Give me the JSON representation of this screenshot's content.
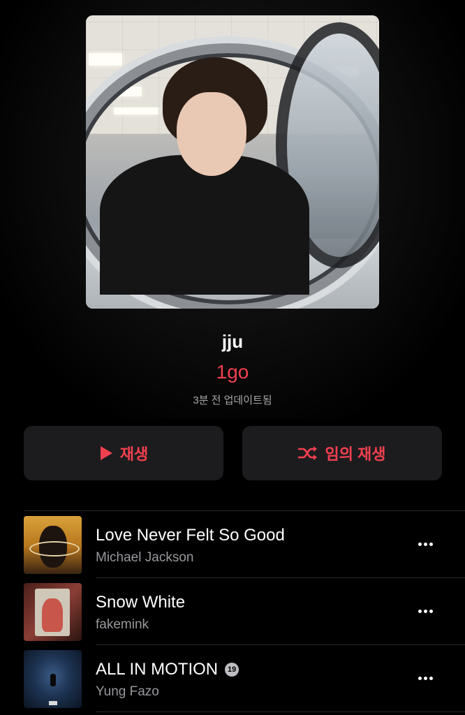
{
  "playlist": {
    "title": "jju",
    "curator": "1go",
    "updated": "3분 전 업데이트됨"
  },
  "actions": {
    "play_label": "재생",
    "shuffle_label": "임의 재생"
  },
  "tracks": [
    {
      "title": "Love Never Felt So Good",
      "artist": "Michael Jackson",
      "explicit": false
    },
    {
      "title": "Snow White",
      "artist": "fakemink",
      "explicit": false
    },
    {
      "title": "ALL IN MOTION",
      "artist": "Yung Fazo",
      "explicit": true,
      "explicit_badge": "19"
    }
  ],
  "colors": {
    "accent": "#f2404f",
    "background": "#000000",
    "button_bg": "#1c1c1e",
    "secondary_text": "#98989d"
  },
  "icons": {
    "play": "play-icon",
    "shuffle": "shuffle-icon",
    "more": "more-icon"
  }
}
